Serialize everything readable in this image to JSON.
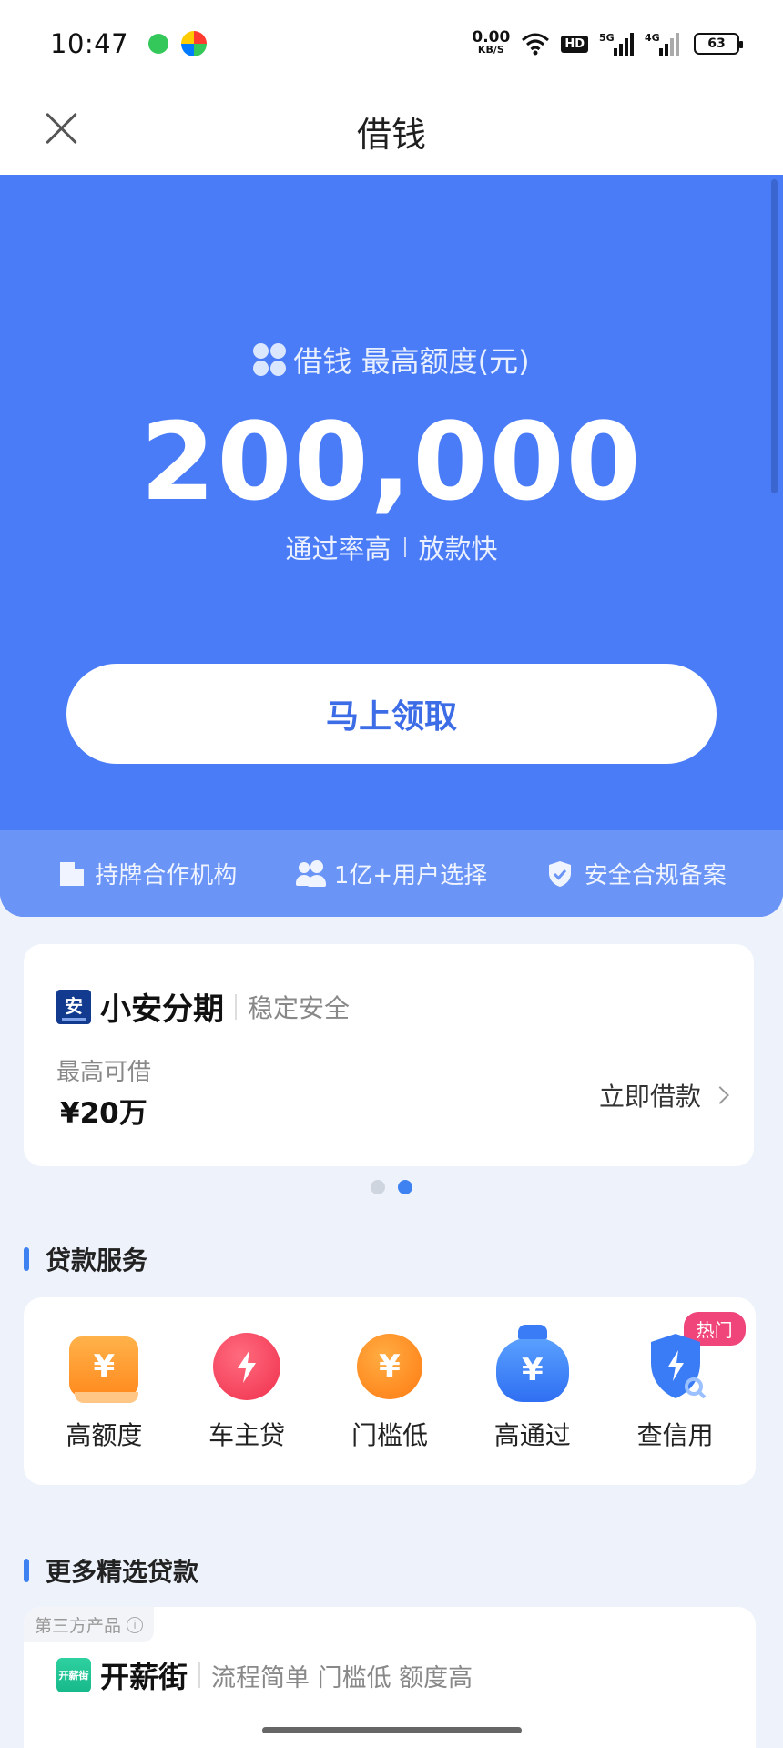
{
  "status_bar": {
    "time": "10:47",
    "net_speed_value": "0.00",
    "net_speed_unit": "KB/S",
    "hd": "HD",
    "signal1": "5G",
    "signal2": "4G",
    "battery": "63"
  },
  "nav": {
    "title": "借钱"
  },
  "hero": {
    "label": "借钱 最高额度(元)",
    "amount": "200,000",
    "tag1": "通过率高",
    "tag2": "放款快",
    "cta": "马上领取",
    "accent_color": "#4a7cf7"
  },
  "trust": [
    {
      "label": "持牌合作机构"
    },
    {
      "label": "1亿+用户选择"
    },
    {
      "label": "安全合规备案"
    }
  ],
  "product": {
    "logo_text": "安",
    "name": "小安分期",
    "tagline": "稳定安全",
    "limit_label": "最高可借",
    "limit_value": "¥20万",
    "action": "立即借款"
  },
  "pager": {
    "count": 2,
    "active": 1
  },
  "services": {
    "title": "贷款服务",
    "items": [
      {
        "label": "高额度",
        "icon": "card-yen-icon"
      },
      {
        "label": "车主贷",
        "icon": "bolt-icon"
      },
      {
        "label": "门槛低",
        "icon": "coin-yen-icon"
      },
      {
        "label": "高通过",
        "icon": "money-bag-icon"
      },
      {
        "label": "查信用",
        "icon": "shield-search-icon",
        "badge": "热门"
      }
    ]
  },
  "more": {
    "title": "更多精选贷款",
    "third_party_label": "第三方产品",
    "logo_text": "开薪街",
    "name": "开薪街",
    "tagline": "流程简单 门槛低 额度高"
  }
}
